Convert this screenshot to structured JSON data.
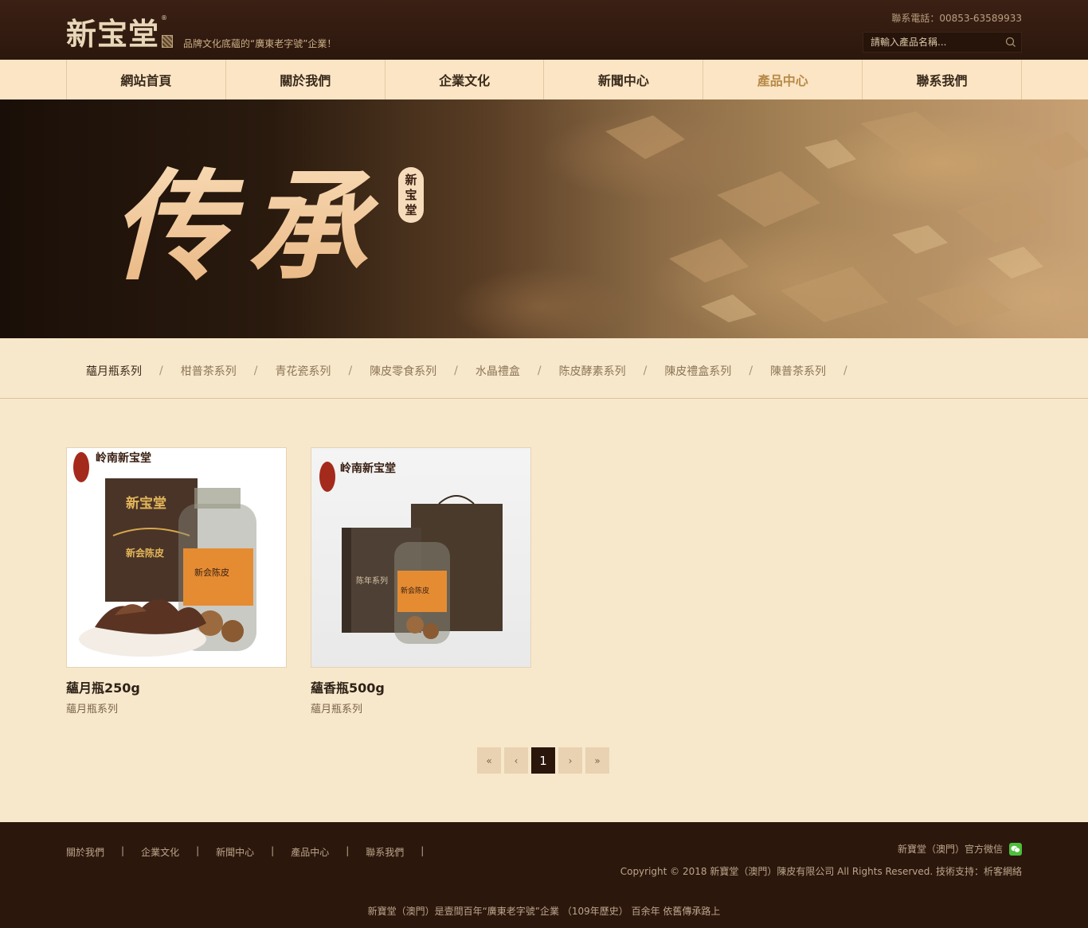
{
  "header": {
    "logo": "新宝堂",
    "logo_mark": "®",
    "slogan": "品牌文化底蘊的“廣東老字號”企業！",
    "phone": "聯系電話：00853-63589933",
    "search_placeholder": "請輸入產品名稱..."
  },
  "nav": {
    "items": [
      {
        "label": "網站首頁"
      },
      {
        "label": "關於我們"
      },
      {
        "label": "企業文化"
      },
      {
        "label": "新聞中心"
      },
      {
        "label": "產品中心",
        "active": true
      },
      {
        "label": "聯系我們"
      }
    ]
  },
  "banner": {
    "title": "传承",
    "seal": [
      "新",
      "宝",
      "堂"
    ]
  },
  "categories": {
    "items": [
      {
        "label": "蘊月瓶系列",
        "active": true
      },
      {
        "label": "柑普茶系列"
      },
      {
        "label": "青花瓷系列"
      },
      {
        "label": "陳皮零食系列"
      },
      {
        "label": "水晶禮盒"
      },
      {
        "label": "陈皮酵素系列"
      },
      {
        "label": "陳皮禮盒系列"
      },
      {
        "label": "陳普茶系列"
      }
    ],
    "separator": "/"
  },
  "products": [
    {
      "title": "蘊月瓶250g",
      "category": "蘊月瓶系列",
      "brand": "岭南新宝堂",
      "box_logo": "新宝堂",
      "box_label": "新会陈皮",
      "jar_label": "新会陈皮"
    },
    {
      "title": "蘊香瓶500g",
      "category": "蘊月瓶系列",
      "brand": "岭南新宝堂",
      "box_label": "陈年系列",
      "jar_label": "新会陈皮"
    }
  ],
  "pagination": {
    "first": "«",
    "prev": "‹",
    "current": "1",
    "next": "›",
    "last": "»"
  },
  "footer": {
    "links": [
      {
        "label": "關於我們"
      },
      {
        "label": "企業文化"
      },
      {
        "label": "新聞中心"
      },
      {
        "label": "產品中心"
      },
      {
        "label": "聯系我們"
      }
    ],
    "separator": "|",
    "wechat": "新寶堂（澳門）官方微信",
    "copyright": "Copyright © 2018 新寶堂（澳門）陳皮有限公司 All Rights Reserved.  技術支持：析客網絡",
    "tagline": "新寶堂（澳門）是壹間百年“廣東老字號”企業 （109年歷史） 百余年 依舊傳承路上"
  },
  "colors": {
    "header_bg": "#2c170d",
    "nav_bg": "#fbe5c4",
    "page_bg": "#f8e8cb",
    "accent": "#b88a4a"
  }
}
